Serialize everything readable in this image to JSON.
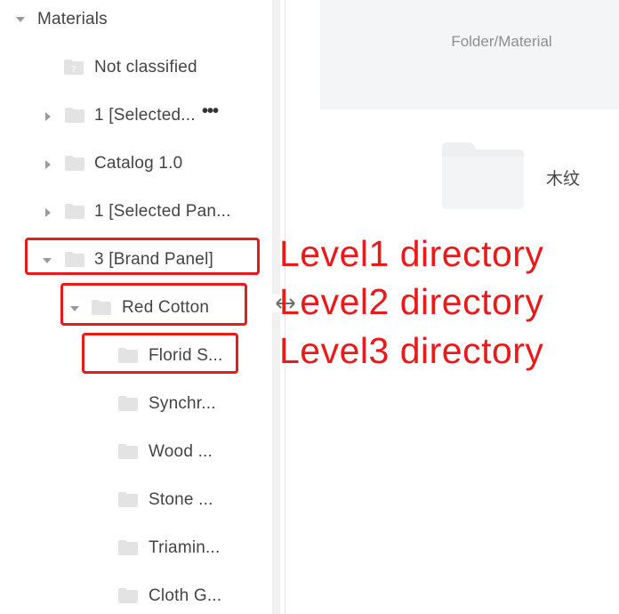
{
  "tree": {
    "root": {
      "label": "Materials",
      "expanded": true
    },
    "items": [
      {
        "label": "Not classified",
        "icon": "question-folder-icon"
      },
      {
        "label": "1 [Selected...",
        "has_more": true,
        "more_label": "•••",
        "expanded": false
      },
      {
        "label": "Catalog 1.0",
        "expanded": false
      },
      {
        "label": "1 [Selected Pan...",
        "expanded": false
      },
      {
        "label": "3 [Brand Panel]",
        "expanded": true
      },
      {
        "label": "Red Cotton",
        "expanded": true
      },
      {
        "label": "Florid S...",
        "selected": true
      },
      {
        "label": "Synchr..."
      },
      {
        "label": "Wood ..."
      },
      {
        "label": "Stone ..."
      },
      {
        "label": "Triamin..."
      },
      {
        "label": "Cloth G..."
      }
    ]
  },
  "content": {
    "header_label": "Folder/Material",
    "folder_name": "木纹"
  },
  "annotations": {
    "level1": "Level1 directory",
    "level2": "Level2 directory",
    "level3": "Level3 directory"
  },
  "colors": {
    "annotation": "#e81a1a",
    "folder": "#e3e3e3",
    "text": "#444444"
  }
}
